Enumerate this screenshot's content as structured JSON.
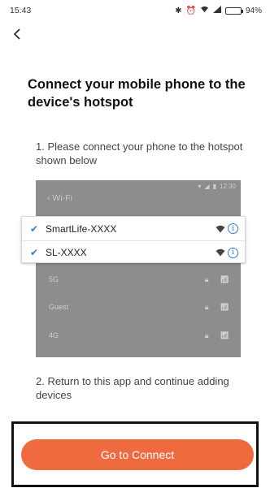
{
  "status_bar": {
    "time": "15:43",
    "battery_pct": "94%",
    "battery_level": 0.94
  },
  "title": "Connect your mobile phone to the device's hotspot",
  "step1": "1. Please connect your phone to the hotspot shown below",
  "illustration": {
    "time": "12:30",
    "header": "Wi-Fi",
    "networks_background": [
      "5G",
      "Guest",
      "4G"
    ],
    "networks_highlighted": [
      "SmartLife-XXXX",
      "SL-XXXX"
    ]
  },
  "step2": "2. Return to this app and continue adding devices",
  "button": {
    "label": "Go to Connect"
  },
  "colors": {
    "accent": "#f06a3f",
    "check": "#2d7fd8",
    "illustration_bg": "#8d8d8d"
  },
  "icons": [
    "bluetooth-icon",
    "alarm-icon",
    "wifi-icon",
    "signal-icon",
    "battery-icon",
    "back-arrow-icon",
    "check-icon",
    "info-icon",
    "lock-icon"
  ]
}
